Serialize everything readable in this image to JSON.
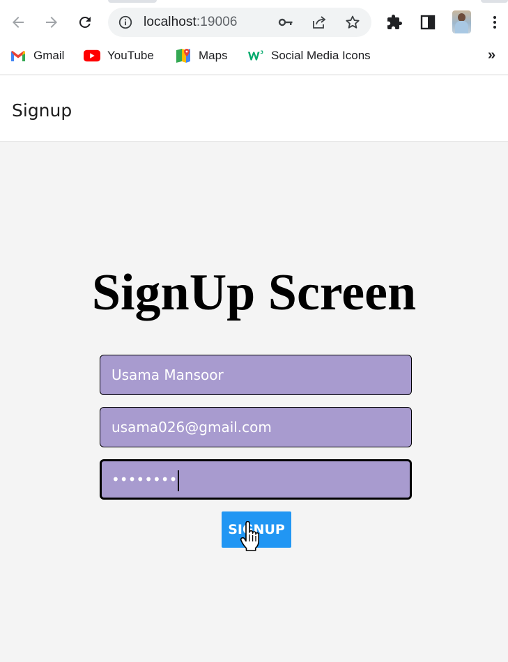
{
  "browser": {
    "url_host": "localhost",
    "url_port": ":19006",
    "icons": {
      "back": "arrow-left-icon",
      "forward": "arrow-right-icon",
      "reload": "reload-icon",
      "site_info": "info-icon",
      "password_key": "key-icon",
      "share": "share-icon",
      "bookmark_star": "star-icon",
      "extensions": "puzzle-icon",
      "side_panel": "side-panel-icon",
      "menu": "kebab-menu-icon"
    },
    "bookmarks": [
      {
        "label": "Gmail",
        "icon": "gmail-icon"
      },
      {
        "label": "YouTube",
        "icon": "youtube-icon"
      },
      {
        "label": "Maps",
        "icon": "maps-icon"
      },
      {
        "label": "Social Media Icons",
        "icon": "w3schools-icon"
      }
    ],
    "bookmarks_more": "»"
  },
  "app": {
    "header_title": "Signup",
    "screen_title": "SignUp Screen",
    "form": {
      "name_value": "Usama Mansoor",
      "email_value": "usama026@gmail.com",
      "password_masked": "••••••••",
      "submit_label": "SIGNUP"
    }
  },
  "colors": {
    "field_background": "#a89bcf",
    "button_background": "#2196f3",
    "page_background": "#f4f4f4"
  }
}
